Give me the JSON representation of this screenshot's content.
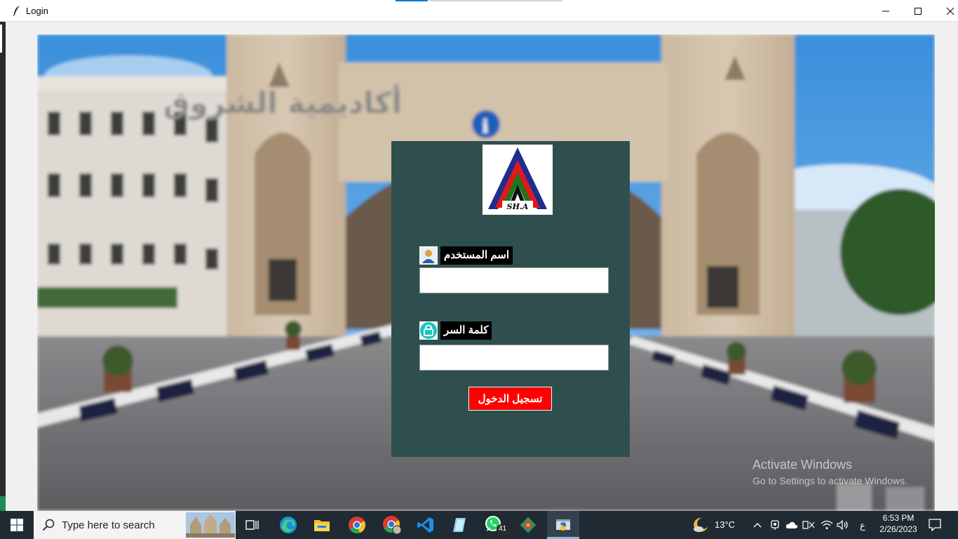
{
  "window": {
    "title": "Login",
    "controls": {
      "minimize": "minimize",
      "maximize": "maximize",
      "close": "close"
    }
  },
  "background": {
    "sign_text": "أكاديمية الشروق"
  },
  "login": {
    "logo_text": "SH.A",
    "username_label": "اسم المستخدم",
    "username_value": "",
    "password_label": "كلمة السر",
    "password_value": "",
    "submit_label": "تسجيل الدخول",
    "colors": {
      "panel": "#2f4f4f",
      "button": "#ff0000"
    }
  },
  "watermark": {
    "line1": "Activate Windows",
    "line2": "Go to Settings to activate Windows."
  },
  "taskbar": {
    "search_placeholder": "Type here to search",
    "apps": [
      "task-view-icon",
      "edge-icon",
      "file-explorer-icon",
      "chrome-icon",
      "chrome-profile-icon",
      "vscode-icon",
      "notepad-icon",
      "whatsapp-icon",
      "git-icon",
      "python-icon"
    ],
    "whatsapp_badge": "41",
    "weather": "13°C",
    "input_lang": "ع",
    "time": "6:53 PM",
    "date": "2/26/2023"
  }
}
